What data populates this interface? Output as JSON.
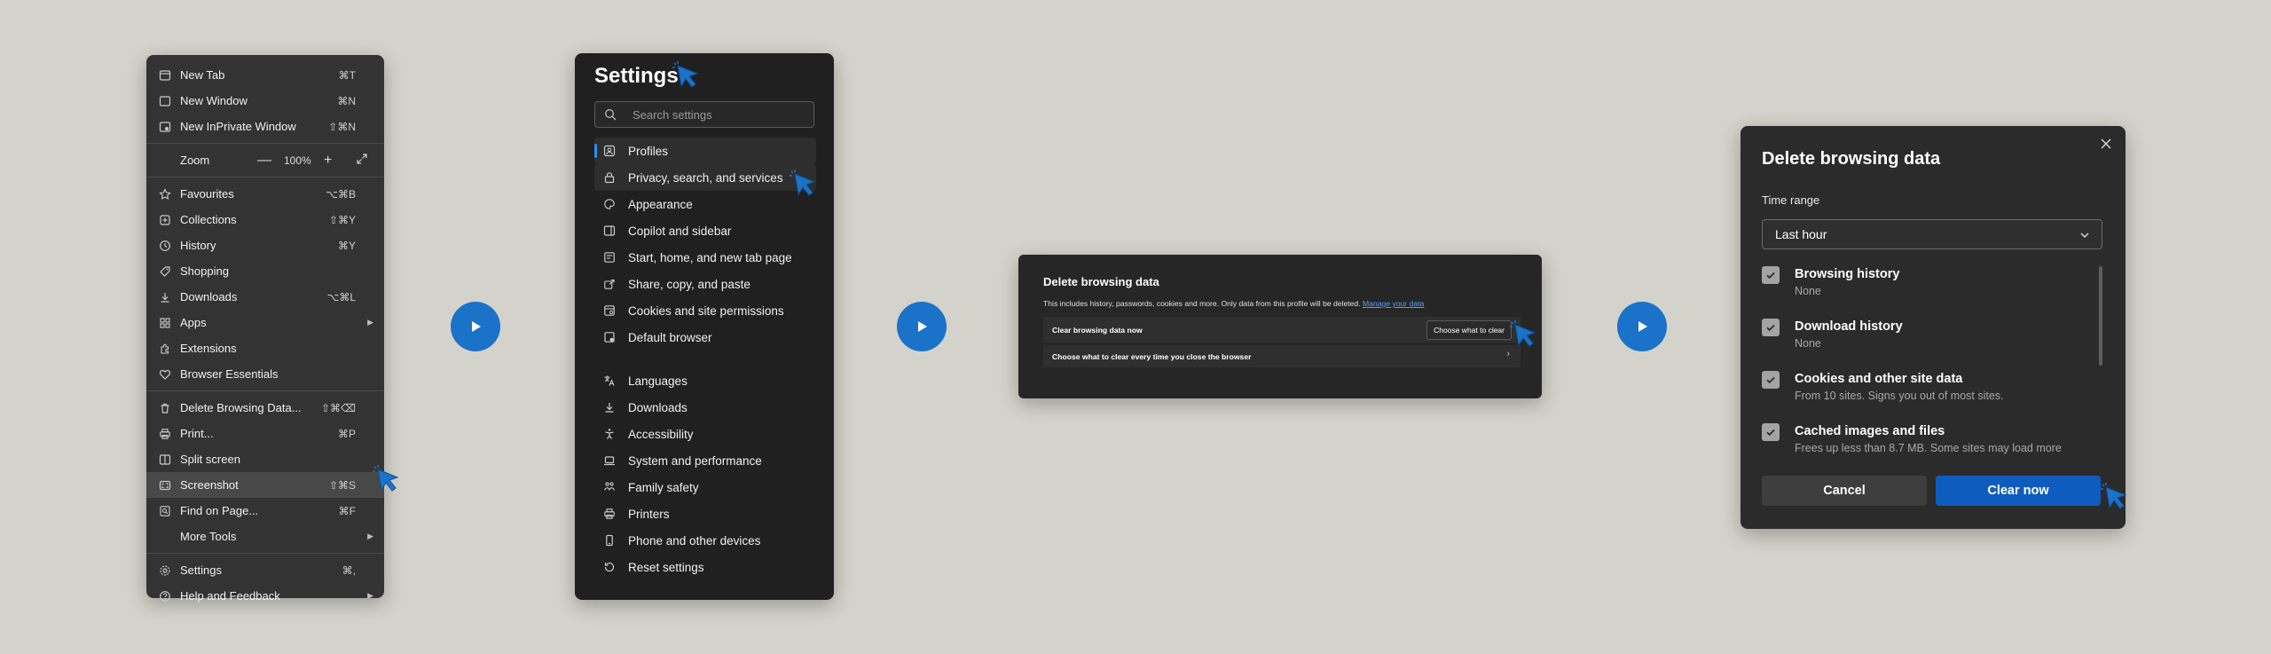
{
  "colors": {
    "background": "#d3d3cb",
    "accent": "#1a73c8",
    "primary_button": "#0f5cbf",
    "panel_dark": "#2b2b2b"
  },
  "menu": {
    "items": [
      {
        "label": "New Tab",
        "shortcut": "⌘T",
        "icon": "new-tab-icon"
      },
      {
        "label": "New Window",
        "shortcut": "⌘N",
        "icon": "new-window-icon"
      },
      {
        "label": "New InPrivate Window",
        "shortcut": "⇧⌘N",
        "icon": "inprivate-icon"
      },
      {
        "label": "Zoom",
        "zoom_value": "100%",
        "minus": "—",
        "plus": "+"
      },
      {
        "label": "Favourites",
        "shortcut": "⌥⌘B",
        "icon": "favourites-icon"
      },
      {
        "label": "Collections",
        "shortcut": "⇧⌘Y",
        "icon": "collections-icon"
      },
      {
        "label": "History",
        "shortcut": "⌘Y",
        "icon": "history-icon"
      },
      {
        "label": "Shopping",
        "shortcut": "",
        "icon": "shopping-tag-icon"
      },
      {
        "label": "Downloads",
        "shortcut": "⌥⌘L",
        "icon": "downloads-icon"
      },
      {
        "label": "Apps",
        "shortcut": "",
        "icon": "apps-icon"
      },
      {
        "label": "Extensions",
        "shortcut": "",
        "icon": "extensions-icon"
      },
      {
        "label": "Browser Essentials",
        "shortcut": "",
        "icon": "heart-icon"
      },
      {
        "label": "Delete Browsing Data...",
        "shortcut": "⇧⌘⌫",
        "icon": "trash-icon"
      },
      {
        "label": "Print...",
        "shortcut": "⌘P",
        "icon": "print-icon"
      },
      {
        "label": "Split screen",
        "shortcut": "",
        "icon": "split-screen-icon"
      },
      {
        "label": "Screenshot",
        "shortcut": "⇧⌘S",
        "icon": "screenshot-icon"
      },
      {
        "label": "Find on Page...",
        "shortcut": "⌘F",
        "icon": "find-icon"
      },
      {
        "label": "More Tools",
        "shortcut": "",
        "icon": ""
      },
      {
        "label": "Settings",
        "shortcut": "⌘,",
        "icon": "gear-icon"
      },
      {
        "label": "Help and Feedback",
        "shortcut": "",
        "icon": "help-icon"
      }
    ]
  },
  "settings": {
    "title": "Settings",
    "search_placeholder": "Search settings",
    "items": [
      {
        "label": "Profiles",
        "icon": "profile-icon"
      },
      {
        "label": "Privacy, search, and services",
        "icon": "lock-icon"
      },
      {
        "label": "Appearance",
        "icon": "appearance-icon"
      },
      {
        "label": "Copilot and sidebar",
        "icon": "sidebar-icon"
      },
      {
        "label": "Start, home, and new tab page",
        "icon": "home-icon"
      },
      {
        "label": "Share, copy, and paste",
        "icon": "share-icon"
      },
      {
        "label": "Cookies and site permissions",
        "icon": "cookies-icon"
      },
      {
        "label": "Default browser",
        "icon": "browser-icon"
      },
      {
        "label": "Languages",
        "icon": "languages-icon"
      },
      {
        "label": "Downloads",
        "icon": "download-icon"
      },
      {
        "label": "Accessibility",
        "icon": "accessibility-icon"
      },
      {
        "label": "System and performance",
        "icon": "laptop-icon"
      },
      {
        "label": "Family safety",
        "icon": "family-icon"
      },
      {
        "label": "Printers",
        "icon": "printer-icon"
      },
      {
        "label": "Phone and other devices",
        "icon": "phone-icon"
      },
      {
        "label": "Reset settings",
        "icon": "reset-icon"
      }
    ]
  },
  "privacy_dialog": {
    "title": "Delete browsing data",
    "description": "This includes history, passwords, cookies and more. Only data from this profile will be deleted.",
    "manage_link": "Manage your data",
    "row1_label": "Clear browsing data now",
    "row1_button": "Choose what to clear",
    "row2_label": "Choose what to clear every time you close the browser"
  },
  "delete_dialog": {
    "title": "Delete browsing data",
    "time_range_label": "Time range",
    "time_range_value": "Last hour",
    "options": [
      {
        "title": "Browsing history",
        "subtitle": "None",
        "checked": true
      },
      {
        "title": "Download history",
        "subtitle": "None",
        "checked": true
      },
      {
        "title": "Cookies and other site data",
        "subtitle": "From 10 sites. Signs you out of most sites.",
        "checked": true
      },
      {
        "title": "Cached images and files",
        "subtitle": "Frees up less than 8.7 MB. Some sites may load more",
        "checked": true
      }
    ],
    "cancel_label": "Cancel",
    "clear_label": "Clear now"
  }
}
